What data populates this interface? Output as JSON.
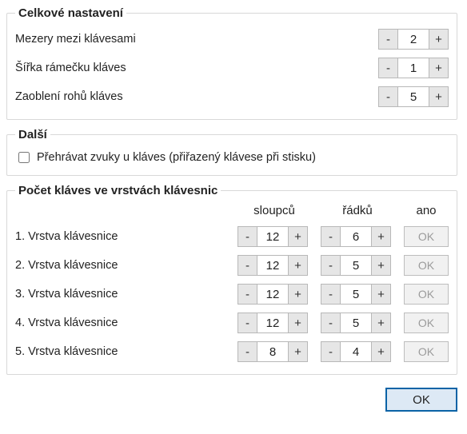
{
  "overall": {
    "legend": "Celkové nastavení",
    "rows": [
      {
        "label": "Mezery mezi klávesami",
        "value": "2"
      },
      {
        "label": "Šířka rámečku kláves",
        "value": "1"
      },
      {
        "label": "Zaoblení rohů kláves",
        "value": "5"
      }
    ]
  },
  "other": {
    "legend": "Další",
    "checkbox_label": "Přehrávat zvuky u kláves (přiřazený klávese při stisku)",
    "checked": false
  },
  "layers": {
    "legend": "Počet kláves ve vrstvách klávesnic",
    "col_cols": "sloupců",
    "col_rows": "řádků",
    "col_ok": "ano",
    "ok_label": "OK",
    "rows": [
      {
        "label": "1. Vrstva klávesnice",
        "cols": "12",
        "rows": "6"
      },
      {
        "label": "2. Vrstva klávesnice",
        "cols": "12",
        "rows": "5"
      },
      {
        "label": "3. Vrstva klávesnice",
        "cols": "12",
        "rows": "5"
      },
      {
        "label": "4. Vrstva klávesnice",
        "cols": "12",
        "rows": "5"
      },
      {
        "label": "5. Vrstva klávesnice",
        "cols": "8",
        "rows": "4"
      }
    ]
  },
  "glyphs": {
    "minus": "-",
    "plus": "+"
  },
  "footer": {
    "ok": "OK"
  }
}
